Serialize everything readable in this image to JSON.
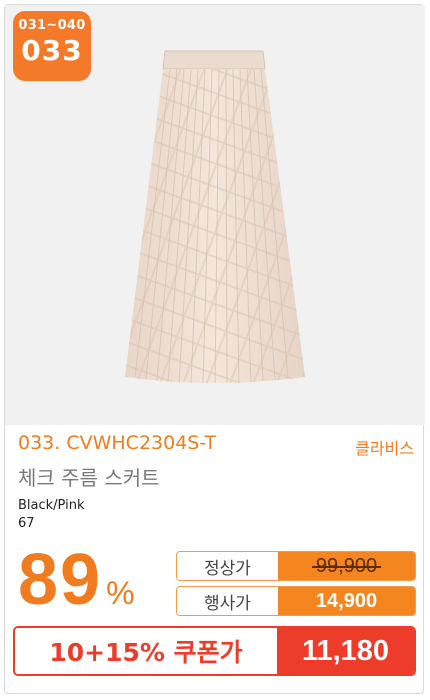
{
  "badge": {
    "range": "031~040",
    "number": "033"
  },
  "product": {
    "code": "033. CVWHC2304S-T",
    "brand": "클라비스",
    "name": "체크 주름 스커트",
    "color": "Black/Pink",
    "size": "67",
    "image_icon": "pleated-skirt-icon"
  },
  "pricing": {
    "discount": "89",
    "discount_unit": "%",
    "regular_label": "정상가",
    "regular_price": "99,900",
    "event_label": "행사가",
    "event_price": "14,900",
    "coupon_label": "10+15% 쿠폰가",
    "coupon_price": "11,180"
  },
  "colors": {
    "accent": "#f5861f",
    "coupon": "#ee3c2a"
  }
}
